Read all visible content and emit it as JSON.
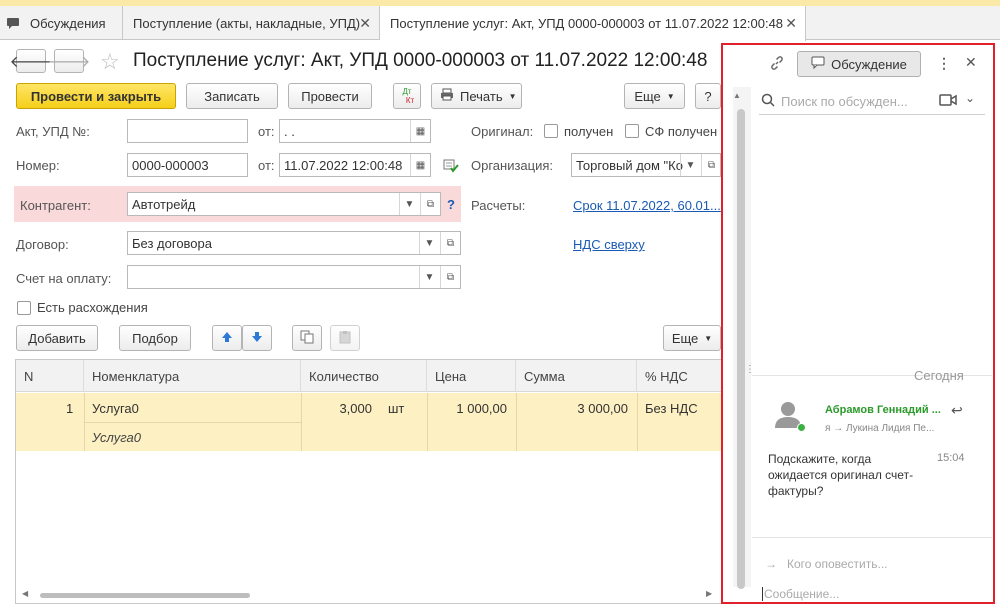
{
  "tabs": [
    {
      "label": "Обсуждения"
    },
    {
      "label": "Поступление (акты, накладные, УПД)"
    },
    {
      "label": "Поступление услуг: Акт, УПД 0000-000003 от 11.07.2022 12:00:48"
    }
  ],
  "form": {
    "title": "Поступление услуг: Акт, УПД 0000-000003 от 11.07.2022 12:00:48",
    "toolbar": {
      "post_close": "Провести и закрыть",
      "save": "Записать",
      "post": "Провести",
      "dtkt_top": "Дт",
      "dtkt_bottom": "Кт",
      "print": "Печать",
      "more": "Еще",
      "help": "?"
    },
    "fields": {
      "act_label": "Акт, УПД №:",
      "act_value": "",
      "from_label": "от:",
      "act_date": " .  .",
      "number_label": "Номер:",
      "number_value": "0000-000003",
      "date_value": "11.07.2022 12:00:48",
      "original_label": "Оригинал:",
      "received_label": "получен",
      "sf_received_label": "СФ получен",
      "org_label": "Организация:",
      "org_value": "Торговый дом \"Ко",
      "counterparty_label": "Контрагент:",
      "counterparty_value": "Автотрейд",
      "counterparty_help": "?",
      "calc_label": "Расчеты:",
      "calc_value": "Срок 11.07.2022, 60.01...",
      "vat_link": "НДС сверху",
      "contract_label": "Договор:",
      "contract_value": "Без договора",
      "invoice_label": "Счет на оплату:",
      "invoice_value": "",
      "discrepancy_label": "Есть расхождения"
    },
    "table_toolbar": {
      "add": "Добавить",
      "pick": "Подбор",
      "more": "Еще"
    },
    "table": {
      "columns": [
        "N",
        "Номенклатура",
        "Количество",
        "Цена",
        "Сумма",
        "% НДС"
      ],
      "rows": [
        {
          "n": "1",
          "item": "Услуга0",
          "item_desc": "Услуга0",
          "qty": "3,000",
          "unit": "шт",
          "price": "1 000,00",
          "sum": "3 000,00",
          "vat": "Без НДС"
        }
      ]
    }
  },
  "discussion": {
    "header_button": "Обсуждение",
    "search_placeholder": "Поиск по обсужден...",
    "date_divider": "Сегодня",
    "message": {
      "author": "Абрамов Геннадий ...",
      "recipients": "я → Лукина Лидия Пе...",
      "time": "15:04",
      "text": "Подскажите, когда ожидается оригинал счет-фактуры?"
    },
    "notify_placeholder": "Кого оповестить...",
    "message_placeholder": "Сообщение..."
  },
  "colors": {
    "accent_red": "#e0212b",
    "primary_yellow": "#f5cf1a",
    "selected_row": "#fdf0c3",
    "counterparty_bg": "#f9d9d9",
    "author_green": "#2a9a2a",
    "link_blue": "#1a5ab5"
  }
}
